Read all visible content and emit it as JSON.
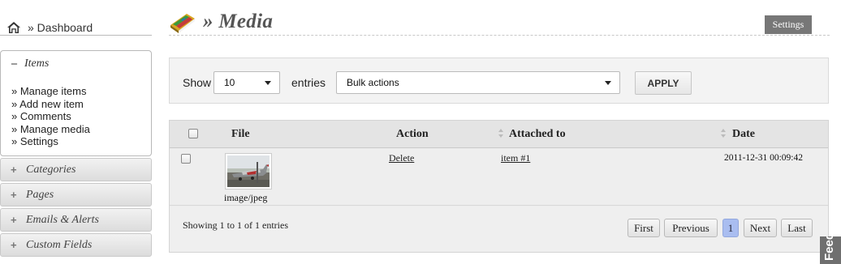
{
  "breadcrumb": {
    "dashboard_label": "» Dashboard",
    "home_icon": "home-icon"
  },
  "sidebar": {
    "items_panel": {
      "title": "Items",
      "toggle": "–",
      "links": [
        "» Manage items",
        "» Add new item",
        "» Comments",
        "» Manage media",
        "» Settings"
      ]
    },
    "sections": [
      {
        "toggle": "+",
        "label": "Categories"
      },
      {
        "toggle": "+",
        "label": "Pages"
      },
      {
        "toggle": "+",
        "label": "Emails & Alerts"
      },
      {
        "toggle": "+",
        "label": "Custom Fields"
      }
    ]
  },
  "header": {
    "title": "» Media",
    "icon": "book-icon",
    "settings_label": "Settings"
  },
  "filters": {
    "show_label": "Show",
    "page_size": "10",
    "entries_label": "entries",
    "bulk_action": "Bulk actions",
    "apply_label": "APPLY"
  },
  "table": {
    "columns": {
      "file": "File",
      "action": "Action",
      "attached": "Attached to",
      "date": "Date"
    },
    "rows": [
      {
        "mime": "image/jpeg",
        "action": "Delete",
        "attached": "item #1",
        "date": "2011-12-31 00:09:42",
        "thumbnail": "airplane-photo"
      }
    ],
    "summary": "Showing 1 to 1 of 1 entries"
  },
  "pagination": {
    "first": "First",
    "previous": "Previous",
    "current": "1",
    "next": "Next",
    "last": "Last"
  },
  "feedback_label": "Feedback",
  "colors": {
    "active_page": "#a9bdf0",
    "settings_button": "#777777",
    "feedback_tab": "#6f6f6f"
  }
}
